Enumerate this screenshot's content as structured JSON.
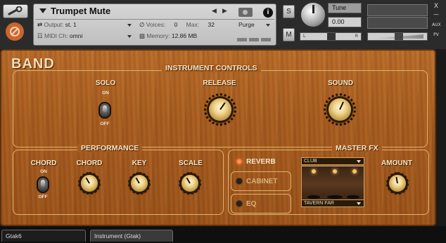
{
  "header": {
    "instrument_name": "Trumpet Mute",
    "output_label": "Output:",
    "output_value": "st. 1",
    "voices_label": "Voices:",
    "voices_value": "0",
    "max_label": "Max:",
    "max_value": "32",
    "purge_label": "Purge",
    "midi_label": "MIDI Ch:",
    "midi_value": "omni",
    "memory_label": "Memory:",
    "memory_value": "12.86 MB",
    "info_label": "i",
    "solo_btn": "S",
    "mute_btn": "M",
    "tune_label": "Tune",
    "tune_value": "0.00",
    "pan_left": "L",
    "pan_right": "R",
    "aux_label": "AUX",
    "pv_label": "PV",
    "close_label": "X"
  },
  "instrument": {
    "title": "BAND",
    "controls_title": "INSTRUMENT CONTROLS",
    "solo_label": "SOLO",
    "solo_on": "ON",
    "solo_off": "OFF",
    "release_label": "RELEASE",
    "sound_label": "SOUND",
    "performance_title": "PERFORMANCE",
    "chord_toggle_label": "CHORD",
    "chord_on": "ON",
    "chord_off": "OFF",
    "chord_knob_label": "CHORD",
    "key_label": "KEY",
    "scale_label": "SCALE",
    "master_fx_title": "MASTER FX",
    "reverb_label": "REVERB",
    "cabinet_label": "CABINET",
    "eq_label": "EQ",
    "room_select": "CLUB",
    "preset_select": "TAVERN FAR",
    "amount_label": "AMOUNT"
  },
  "tabs": {
    "tab1": "Gtak6",
    "tab2": "Instrument (Gtak)"
  },
  "colors": {
    "wood": "#a85c1f",
    "accent_orange": "#e0561a",
    "label": "#f5e6c8"
  }
}
